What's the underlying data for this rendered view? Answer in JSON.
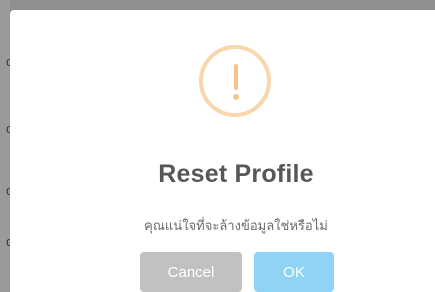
{
  "dialog": {
    "title": "Reset Profile",
    "message": "คุณแน่ใจที่จะล้างข้อมูลใช่หรือไม่",
    "icon": "warning-icon",
    "icon_color": "#f8bb86",
    "buttons": {
      "cancel_label": "Cancel",
      "ok_label": "OK",
      "cancel_color": "#c1c1c1",
      "ok_color": "#8cd4f5"
    }
  },
  "background": {
    "overlay_color": "#8f8f8f",
    "left_fragments": [
      "0",
      "0",
      "0",
      "0"
    ]
  }
}
